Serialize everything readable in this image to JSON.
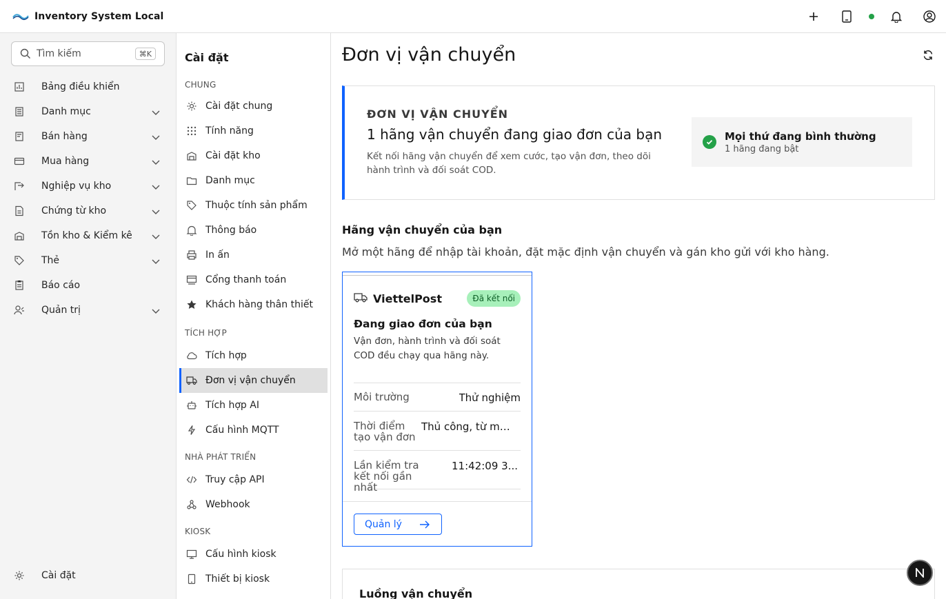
{
  "app": {
    "title": "Inventory System Local"
  },
  "search": {
    "placeholder": "Tìm kiếm",
    "shortcut": "⌘K"
  },
  "nav": {
    "items": [
      {
        "label": "Bảng điều khiển",
        "icon": "dashboard-icon",
        "expandable": false
      },
      {
        "label": "Danh mục",
        "icon": "catalog-icon",
        "expandable": true
      },
      {
        "label": "Bán hàng",
        "icon": "sales-icon",
        "expandable": true
      },
      {
        "label": "Mua hàng",
        "icon": "purchase-icon",
        "expandable": true
      },
      {
        "label": "Nghiệp vụ kho",
        "icon": "warehouse-ops-icon",
        "expandable": true
      },
      {
        "label": "Chứng từ kho",
        "icon": "document-icon",
        "expandable": true
      },
      {
        "label": "Tồn kho & Kiểm kê",
        "icon": "inventory-icon",
        "expandable": true
      },
      {
        "label": "Thẻ",
        "icon": "tag-icon",
        "expandable": true
      },
      {
        "label": "Báo cáo",
        "icon": "report-icon",
        "expandable": false
      },
      {
        "label": "Quản trị",
        "icon": "admin-icon",
        "expandable": true
      }
    ],
    "settings_label": "Cài đặt"
  },
  "settings_nav": {
    "title": "Cài đặt",
    "sections": [
      {
        "label": "CHUNG",
        "items": [
          {
            "label": "Cài đặt chung",
            "icon": "gear-icon"
          },
          {
            "label": "Tính năng",
            "icon": "grid-icon"
          },
          {
            "label": "Cài đặt kho",
            "icon": "warehouse-icon"
          },
          {
            "label": "Danh mục",
            "icon": "folder-icon"
          },
          {
            "label": "Thuộc tính sản phẩm",
            "icon": "tag-icon"
          },
          {
            "label": "Thông báo",
            "icon": "bell-icon"
          },
          {
            "label": "In ấn",
            "icon": "printer-icon"
          },
          {
            "label": "Cổng thanh toán",
            "icon": "payment-icon"
          },
          {
            "label": "Khách hàng thân thiết",
            "icon": "star-icon"
          }
        ]
      },
      {
        "label": "TÍCH HỢP",
        "items": [
          {
            "label": "Tích hợp",
            "icon": "cloud-icon"
          },
          {
            "label": "Đơn vị vận chuyển",
            "icon": "truck-icon",
            "active": true
          },
          {
            "label": "Tích hợp AI",
            "icon": "robot-icon"
          },
          {
            "label": "Cấu hình MQTT",
            "icon": "lightning-icon"
          }
        ]
      },
      {
        "label": "NHÀ PHÁT TRIỂN",
        "items": [
          {
            "label": "Truy cập API",
            "icon": "code-icon"
          },
          {
            "label": "Webhook",
            "icon": "webhook-icon"
          }
        ]
      },
      {
        "label": "KIOSK",
        "items": [
          {
            "label": "Cấu hình kiosk",
            "icon": "monitor-icon"
          },
          {
            "label": "Thiết bị kiosk",
            "icon": "device-icon"
          }
        ]
      }
    ]
  },
  "main": {
    "title": "Đơn vị vận chuyển",
    "hero": {
      "kicker": "ĐƠN VỊ VẬN CHUYỂN",
      "title": "1 hãng vận chuyển đang giao đơn của bạn",
      "description": "Kết nối hãng vận chuyển để xem cước, tạo vận đơn, theo dõi hành trình và đối soát COD.",
      "status_title": "Mọi thứ đang bình thường",
      "status_sub": "1 hãng đang bật"
    },
    "carriers_title": "Hãng vận chuyển của bạn",
    "carriers_desc": "Mở một hãng để nhập tài khoản, đặt mặc định vận chuyển và gán kho gửi với kho hàng.",
    "carrier": {
      "name": "ViettelPost",
      "badge": "Đã kết nối",
      "subtitle": "Đang giao đơn của bạn",
      "description": "Vận đơn, hành trình và đối soát COD đều chạy qua hãng này.",
      "rows": [
        {
          "key": "Môi trường",
          "value": "Thử nghiệm"
        },
        {
          "key": "Thời điểm tạo vận đơn",
          "value": "Thủ công, từ mà..."
        },
        {
          "key": "Lần kiểm tra kết nối gần nhất",
          "value": "11:42:09 3..."
        }
      ],
      "action": "Quản lý"
    },
    "flow_title": "Luồng vận chuyển"
  },
  "colors": {
    "accent": "#0f62fe",
    "success": "#24a148",
    "badge_bg": "#a7f0ba"
  }
}
